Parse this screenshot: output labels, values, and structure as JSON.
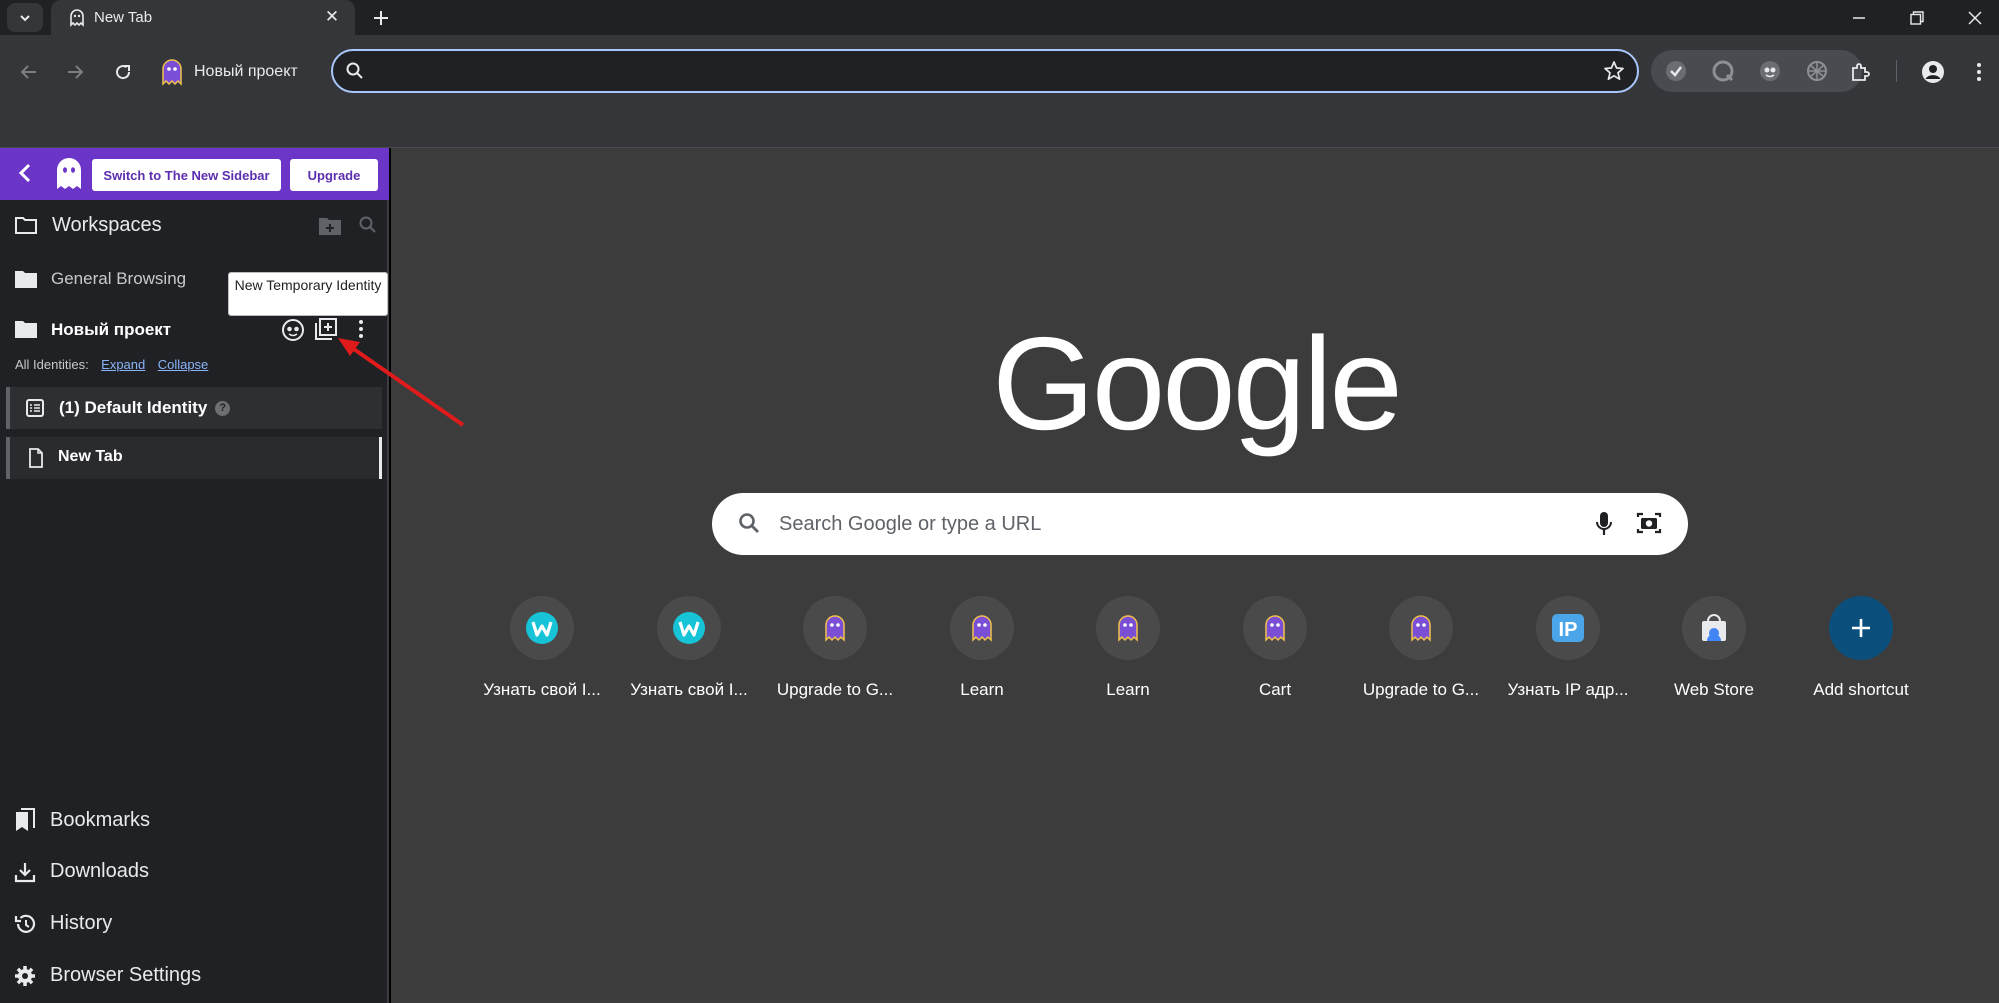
{
  "tab": {
    "title": "New Tab",
    "close": "✕"
  },
  "toolbar": {
    "profile_name": "Новый проект",
    "omnibox_value": ""
  },
  "sidebar": {
    "switch_button": "Switch to The New Sidebar",
    "upgrade_button": "Upgrade",
    "workspaces_title": "Workspaces",
    "workspaces": [
      {
        "label": "General Browsing"
      },
      {
        "label": "Новый проект"
      }
    ],
    "tooltip": "New Temporary Identity",
    "all_identities_label": "All Identities:",
    "expand_link": "Expand",
    "collapse_link": "Collapse",
    "identity_name": "(1) Default Identity",
    "identity_help": "?",
    "identity_tab": "New Tab",
    "bottom": [
      {
        "label": "Bookmarks",
        "icon": "bookmarks-icon"
      },
      {
        "label": "Downloads",
        "icon": "download-icon"
      },
      {
        "label": "History",
        "icon": "history-icon"
      },
      {
        "label": "Browser Settings",
        "icon": "gear-icon"
      }
    ]
  },
  "ntp": {
    "logo": "Google",
    "search_placeholder": "Search Google or type a URL",
    "shortcuts": [
      {
        "label": "Узнать свой I...",
        "icon": "w-logo-icon"
      },
      {
        "label": "Узнать свой I...",
        "icon": "w-logo-icon"
      },
      {
        "label": "Upgrade to G...",
        "icon": "ghost-icon"
      },
      {
        "label": "Learn",
        "icon": "ghost-icon"
      },
      {
        "label": "Learn",
        "icon": "ghost-icon"
      },
      {
        "label": "Cart",
        "icon": "ghost-icon"
      },
      {
        "label": "Upgrade to G...",
        "icon": "ghost-icon"
      },
      {
        "label": "Узнать IP адр...",
        "icon": "ip-icon"
      },
      {
        "label": "Web Store",
        "icon": "web-store-icon"
      },
      {
        "label": "Add shortcut",
        "icon": "plus-icon"
      }
    ]
  },
  "colors": {
    "sidebar_header": "#6b35c7",
    "accent_blue": "#a8c7fa",
    "w_logo": "#17c3d6",
    "add_shortcut": "#0b4f7c",
    "annotation_arrow": "#e01b1b"
  }
}
